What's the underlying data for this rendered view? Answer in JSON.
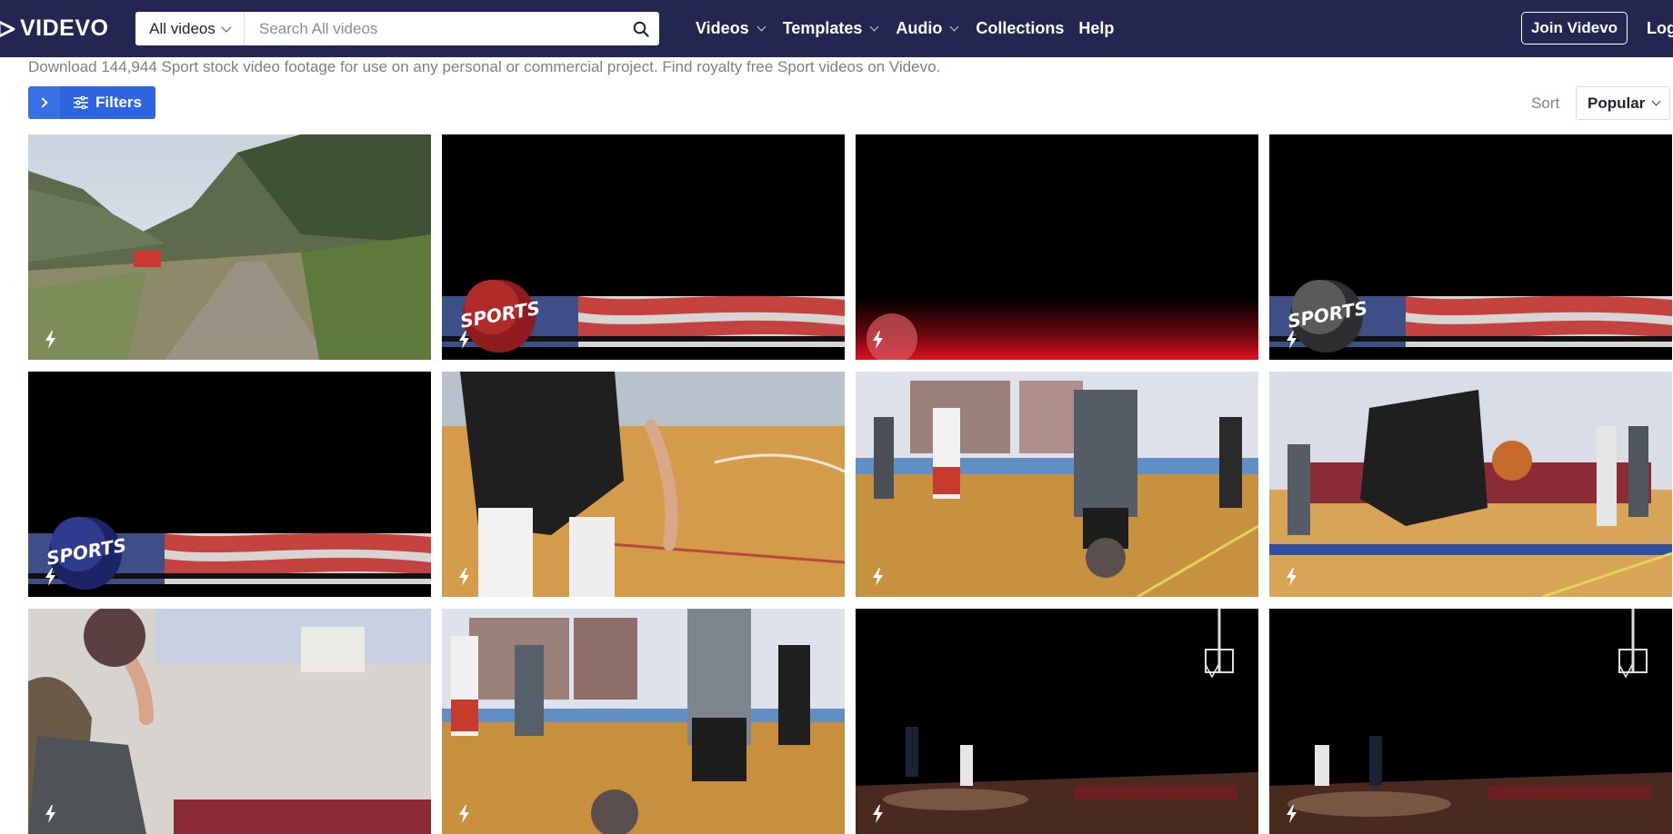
{
  "header": {
    "logo_text": "VIDEVO",
    "search": {
      "type_label": "All videos",
      "placeholder": "Search All videos",
      "value": ""
    },
    "nav": [
      {
        "label": "Videos",
        "has_dropdown": true
      },
      {
        "label": "Templates",
        "has_dropdown": true
      },
      {
        "label": "Audio",
        "has_dropdown": true
      },
      {
        "label": "Collections",
        "has_dropdown": false
      },
      {
        "label": "Help",
        "has_dropdown": false
      }
    ],
    "join_label": "Join Videvo",
    "login_label": "Log"
  },
  "intro_text": "Download 144,944 Sport stock video footage for use on any personal or commercial project. Find royalty free Sport videos on Videvo.",
  "toolbar": {
    "filters_label": "Filters",
    "sort_label": "Sort",
    "sort_value": "Popular"
  },
  "colors": {
    "header_bg": "#232650",
    "accent_blue": "#2f64e0"
  },
  "tiles": [
    {
      "scene": "mountain-dirt-road",
      "icon": "bolt-icon"
    },
    {
      "scene": "sports-lower-third-red-globe",
      "icon": "bolt-icon",
      "overlay_text": "SPORTS"
    },
    {
      "scene": "red-lower-third-bar",
      "icon": "bolt-icon"
    },
    {
      "scene": "sports-lower-third-gray-globe",
      "icon": "bolt-icon",
      "overlay_text": "SPORTS"
    },
    {
      "scene": "sports-lower-third-blue-globe",
      "icon": "bolt-icon",
      "overlay_text": "SPORTS"
    },
    {
      "scene": "basketball-dribble-closeup",
      "icon": "bolt-icon"
    },
    {
      "scene": "basketball-team-practice",
      "icon": "bolt-icon"
    },
    {
      "scene": "basketball-dribbling-drill",
      "icon": "bolt-icon"
    },
    {
      "scene": "basketball-shooting-player",
      "icon": "bolt-icon"
    },
    {
      "scene": "basketball-team-lineup",
      "icon": "bolt-icon"
    },
    {
      "scene": "night-court-one-on-one",
      "icon": "bolt-icon"
    },
    {
      "scene": "night-court-one-on-one-2",
      "icon": "bolt-icon"
    }
  ]
}
